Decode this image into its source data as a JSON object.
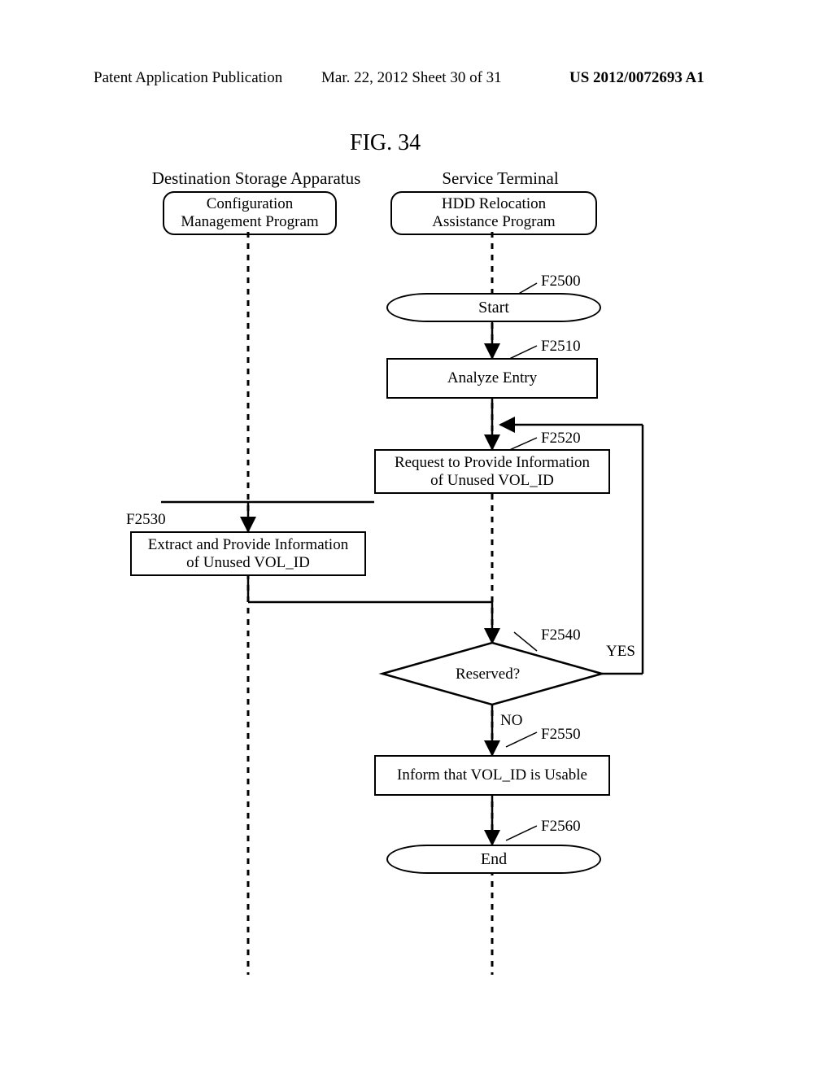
{
  "header": {
    "left": "Patent Application Publication",
    "center": "Mar. 22, 2012  Sheet 30 of 31",
    "right": "US 2012/0072693 A1"
  },
  "figure_title": "FIG. 34",
  "columns": {
    "left_title": "Destination Storage Apparatus",
    "right_title": "Service Terminal"
  },
  "programs": {
    "config_mgmt": "Configuration\nManagement Program",
    "hdd_relocation": "HDD Relocation\nAssistance Program"
  },
  "steps": {
    "start": "Start",
    "analyze": "Analyze Entry",
    "request": "Request to Provide Information\nof Unused VOL_ID",
    "extract": "Extract and Provide Information\nof Unused VOL_ID",
    "reserved": "Reserved?",
    "inform": "Inform that VOL_ID is Usable",
    "end": "End"
  },
  "branches": {
    "yes": "YES",
    "no": "NO"
  },
  "refs": {
    "f2500": "F2500",
    "f2510": "F2510",
    "f2520": "F2520",
    "f2530": "F2530",
    "f2540": "F2540",
    "f2550": "F2550",
    "f2560": "F2560"
  }
}
